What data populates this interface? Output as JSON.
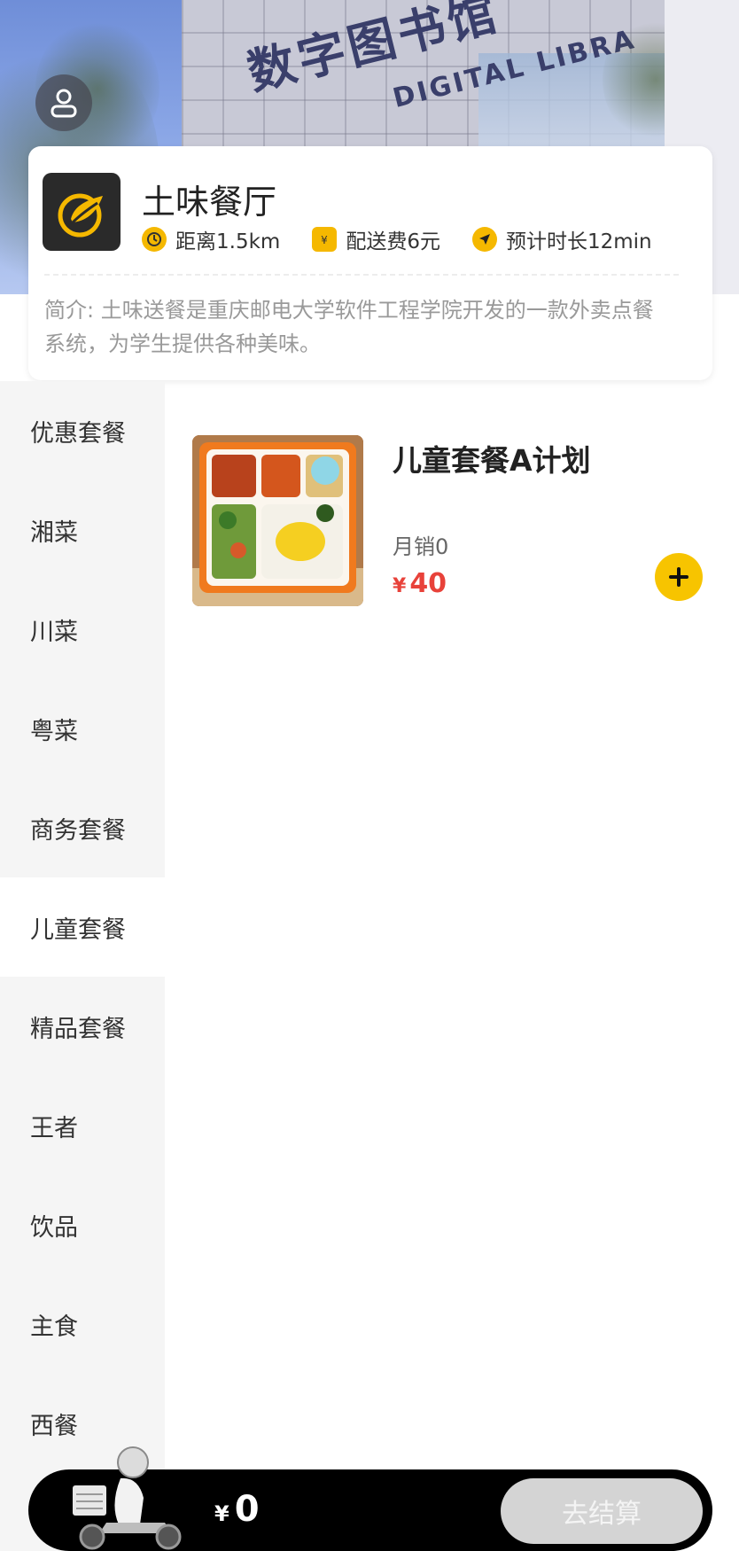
{
  "banner": {
    "sign_cn": "数字图书馆",
    "sign_en": "DIGITAL LIBRA"
  },
  "header": {
    "user_icon": "user-icon"
  },
  "shop": {
    "logo_icon": "leaf-logo-icon",
    "name": "土味餐厅",
    "distance": "距离1.5km",
    "delivery_fee": "配送费6元",
    "estimated_time": "预计时长12min",
    "description": "简介: 土味送餐是重庆邮电大学软件工程学院开发的一款外卖点餐系统，为学生提供各种美味。"
  },
  "categories": {
    "items": [
      "优惠套餐",
      "湘菜",
      "川菜",
      "粤菜",
      "商务套餐",
      "儿童套餐",
      "精品套餐",
      "王者",
      "饮品",
      "主食",
      "西餐"
    ],
    "active": "儿童套餐"
  },
  "product": {
    "name": "儿童套餐A计划",
    "sales": "月销0",
    "currency": "¥",
    "price": "40"
  },
  "cart": {
    "currency": "¥",
    "total": "0",
    "checkout_label": "去结算"
  },
  "colors": {
    "accent": "#f7c400",
    "price": "#e8423a",
    "cart_bar": "#000000",
    "sidebar_bg": "#f5f5f5"
  }
}
